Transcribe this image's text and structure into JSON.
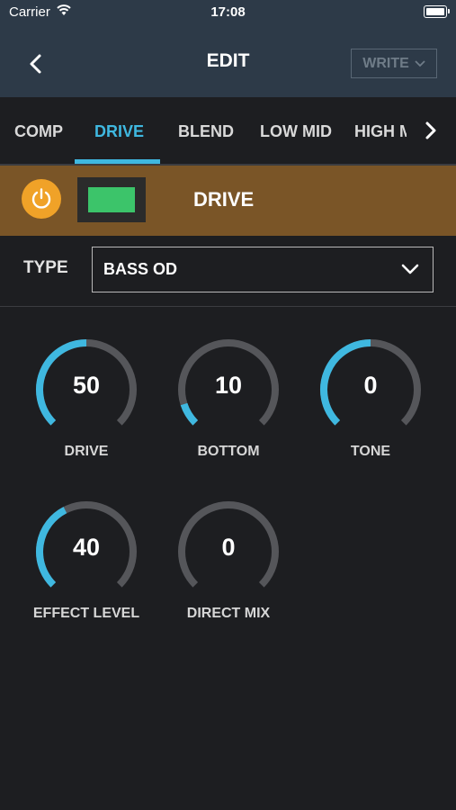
{
  "status_bar": {
    "carrier": "Carrier",
    "time": "17:08"
  },
  "header": {
    "title": "EDIT",
    "write_label": "WRITE"
  },
  "tabs": [
    {
      "label": "COMP",
      "active": false
    },
    {
      "label": "DRIVE",
      "active": true
    },
    {
      "label": "BLEND",
      "active": false
    },
    {
      "label": "LOW MID",
      "active": false
    },
    {
      "label": "HIGH MID",
      "active": false
    }
  ],
  "effect": {
    "title": "DRIVE",
    "enabled": true,
    "color": "#3cc46a"
  },
  "type": {
    "label": "TYPE",
    "value": "BASS OD"
  },
  "knobs": [
    {
      "label": "DRIVE",
      "value": "50",
      "level": 0.5
    },
    {
      "label": "BOTTOM",
      "value": "10",
      "level": 0.1
    },
    {
      "label": "TONE",
      "value": "0",
      "level": 0.5
    },
    {
      "label": "EFFECT LEVEL",
      "value": "40",
      "level": 0.4
    },
    {
      "label": "DIRECT MIX",
      "value": "0",
      "level": 0.0
    }
  ],
  "colors": {
    "accent": "#3fb8e0",
    "header": "#2d3a48",
    "drive_bar": "#7a5527",
    "power": "#f0a228"
  }
}
